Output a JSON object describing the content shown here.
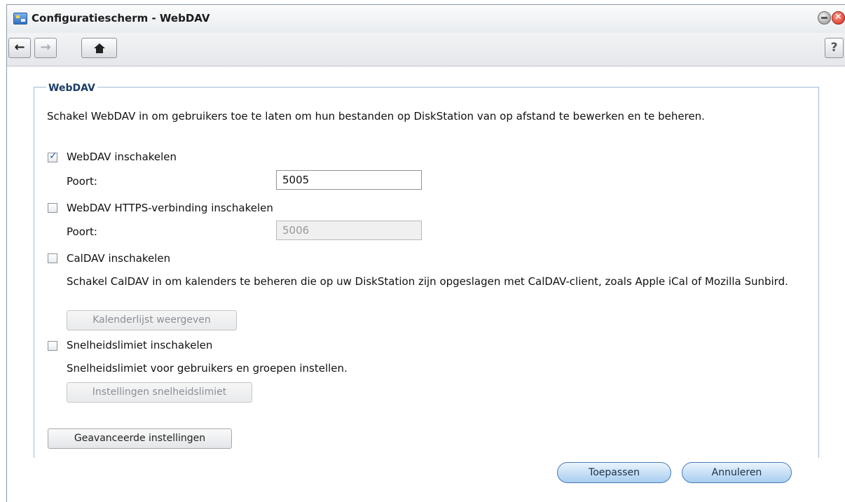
{
  "window": {
    "title": "Configuratiescherm - WebDAV",
    "close_glyph": "✕"
  },
  "toolbar": {
    "back_glyph": "←",
    "forward_glyph": "→",
    "help_glyph": "?"
  },
  "panel": {
    "legend": "WebDAV",
    "description": "Schakel WebDAV in om gebruikers toe te laten om hun bestanden op DiskStation van op afstand te bewerken en te beheren.",
    "webdav": {
      "label": "WebDAV inschakelen",
      "checked": true,
      "port_label": "Poort:",
      "port_value": "5005"
    },
    "https": {
      "label": "WebDAV HTTPS-verbinding inschakelen",
      "checked": false,
      "port_label": "Poort:",
      "port_value": "5006"
    },
    "caldav": {
      "label": "CalDAV inschakelen",
      "checked": false,
      "description": "Schakel CalDAV in om kalenders te beheren die op uw DiskStation zijn opgeslagen met CalDAV-client, zoals Apple iCal of Mozilla Sunbird.",
      "button": "Kalenderlijst weergeven"
    },
    "speed": {
      "label": "Snelheidslimiet inschakelen",
      "checked": false,
      "description": "Snelheidslimiet voor gebruikers en groepen instellen.",
      "button": "Instellingen snelheidslimiet"
    },
    "advanced_button": "Geavanceerde instellingen"
  },
  "footer": {
    "apply": "Toepassen",
    "cancel": "Annuleren"
  }
}
